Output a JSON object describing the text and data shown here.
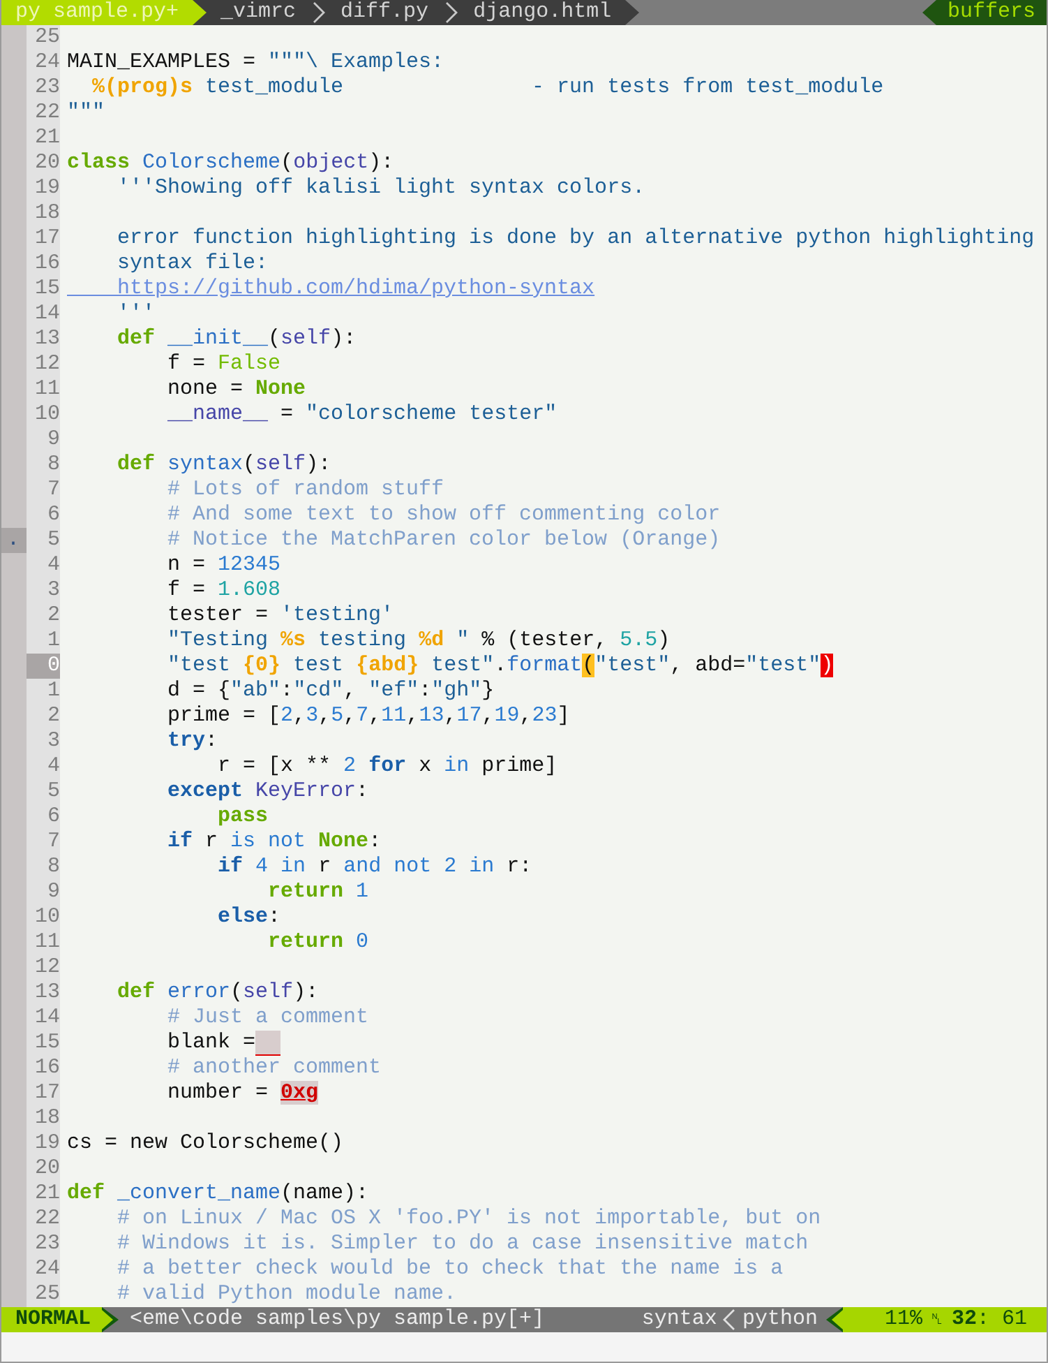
{
  "tabline": {
    "tabs": [
      {
        "label": "py sample.py+",
        "selected": true
      },
      {
        "label": "_vimrc",
        "selected": false
      },
      {
        "label": "diff.py",
        "selected": false
      },
      {
        "label": "django.html",
        "selected": false
      }
    ],
    "buffers_label": "buffers"
  },
  "lines": [
    {
      "number": "25",
      "current": false
    },
    {
      "number": "24",
      "current": false,
      "segments": [
        {
          "text": "MAIN_EXAMPLES = ",
          "kind": "plain"
        },
        {
          "text": "\"\"\"\\ Examples:",
          "kind": "string"
        }
      ]
    },
    {
      "number": "23",
      "current": false,
      "segments": [
        {
          "text": "  %(prog)s",
          "kind": "special"
        },
        {
          "text": " test_module               - run tests from test_module",
          "kind": "string"
        }
      ]
    },
    {
      "number": "22",
      "current": false,
      "segments": [
        {
          "text": "\"\"\"",
          "kind": "string"
        }
      ]
    },
    {
      "number": "21",
      "current": false
    },
    {
      "number": "20",
      "current": false,
      "segments": [
        {
          "text": "class",
          "kind": "keyword"
        },
        {
          "text": " Colorscheme",
          "kind": "function"
        },
        {
          "text": "(",
          "kind": "plain"
        },
        {
          "text": "object",
          "kind": "self"
        },
        {
          "text": "):",
          "kind": "plain"
        }
      ]
    },
    {
      "number": "19",
      "current": false,
      "segments": [
        {
          "text": "    '''Showing off kalisi light syntax colors.",
          "kind": "string"
        }
      ]
    },
    {
      "number": "18",
      "current": false
    },
    {
      "number": "17",
      "current": false,
      "segments": [
        {
          "text": "    error function highlighting is done by an alternative python highlighting",
          "kind": "string"
        }
      ]
    },
    {
      "number": "16",
      "current": false,
      "segments": [
        {
          "text": "    syntax file:",
          "kind": "string"
        }
      ]
    },
    {
      "number": "15",
      "current": false,
      "segments": [
        {
          "text": "    https://github.com/hdima/python-syntax",
          "kind": "url"
        }
      ]
    },
    {
      "number": "14",
      "current": false,
      "segments": [
        {
          "text": "    '''",
          "kind": "string"
        }
      ]
    },
    {
      "number": "13",
      "current": false,
      "segments": [
        {
          "text": "    def",
          "kind": "keyword"
        },
        {
          "text": " __init__",
          "kind": "function"
        },
        {
          "text": "(",
          "kind": "plain"
        },
        {
          "text": "self",
          "kind": "self"
        },
        {
          "text": "):",
          "kind": "plain"
        }
      ]
    },
    {
      "number": "12",
      "current": false,
      "segments": [
        {
          "text": "        f = ",
          "kind": "plain"
        },
        {
          "text": "False",
          "kind": "boolean"
        }
      ]
    },
    {
      "number": "11",
      "current": false,
      "segments": [
        {
          "text": "        none = ",
          "kind": "plain"
        },
        {
          "text": "None",
          "kind": "keyword"
        }
      ]
    },
    {
      "number": "10",
      "current": false,
      "segments": [
        {
          "text": "        __name__",
          "kind": "self"
        },
        {
          "text": " = ",
          "kind": "plain"
        },
        {
          "text": "\"colorscheme tester\"",
          "kind": "string"
        }
      ]
    },
    {
      "number": "9",
      "current": false
    },
    {
      "number": "8",
      "current": false,
      "segments": [
        {
          "text": "    def",
          "kind": "keyword"
        },
        {
          "text": " syntax",
          "kind": "function"
        },
        {
          "text": "(",
          "kind": "plain"
        },
        {
          "text": "self",
          "kind": "self"
        },
        {
          "text": "):",
          "kind": "plain"
        }
      ]
    },
    {
      "number": "7",
      "current": false,
      "segments": [
        {
          "text": "        # Lots of random stuff",
          "kind": "comment"
        }
      ]
    },
    {
      "number": "6",
      "current": false,
      "segments": [
        {
          "text": "        # And some text to show off commenting color",
          "kind": "comment"
        }
      ]
    },
    {
      "number": "5",
      "current": false,
      "sign": ".",
      "segments": [
        {
          "text": "        # Notice the MatchParen color below (Orange)",
          "kind": "comment"
        }
      ]
    },
    {
      "number": "4",
      "current": false,
      "segments": [
        {
          "text": "        n = ",
          "kind": "plain"
        },
        {
          "text": "12345",
          "kind": "number"
        }
      ]
    },
    {
      "number": "3",
      "current": false,
      "segments": [
        {
          "text": "        f = ",
          "kind": "plain"
        },
        {
          "text": "1.608",
          "kind": "float"
        }
      ]
    },
    {
      "number": "2",
      "current": false,
      "segments": [
        {
          "text": "        tester = ",
          "kind": "plain"
        },
        {
          "text": "'testing'",
          "kind": "string"
        }
      ]
    },
    {
      "number": "1",
      "current": false,
      "segments": [
        {
          "text": "        \"Testing ",
          "kind": "string"
        },
        {
          "text": "%s",
          "kind": "special"
        },
        {
          "text": " testing ",
          "kind": "string"
        },
        {
          "text": "%d",
          "kind": "special"
        },
        {
          "text": " \"",
          "kind": "string"
        },
        {
          "text": " % (tester, ",
          "kind": "plain"
        },
        {
          "text": "5.5",
          "kind": "float"
        },
        {
          "text": ")",
          "kind": "plain"
        }
      ]
    },
    {
      "number": "0",
      "current": true,
      "segments": [
        {
          "text": "        \"test ",
          "kind": "string"
        },
        {
          "text": "{0}",
          "kind": "special"
        },
        {
          "text": " test ",
          "kind": "string"
        },
        {
          "text": "{abd}",
          "kind": "special"
        },
        {
          "text": " test\"",
          "kind": "string"
        },
        {
          "text": ".",
          "kind": "plain"
        },
        {
          "text": "format",
          "kind": "function"
        },
        {
          "text": "(",
          "kind": "matchparen"
        },
        {
          "text": "\"test\"",
          "kind": "string"
        },
        {
          "text": ", abd=",
          "kind": "plain"
        },
        {
          "text": "\"test\"",
          "kind": "string"
        },
        {
          "text": ")",
          "kind": "errorparen"
        }
      ]
    },
    {
      "number": "1",
      "current": false,
      "segments": [
        {
          "text": "        d = {",
          "kind": "plain"
        },
        {
          "text": "\"ab\"",
          "kind": "string"
        },
        {
          "text": ":",
          "kind": "plain"
        },
        {
          "text": "\"cd\"",
          "kind": "string"
        },
        {
          "text": ", ",
          "kind": "plain"
        },
        {
          "text": "\"ef\"",
          "kind": "string"
        },
        {
          "text": ":",
          "kind": "plain"
        },
        {
          "text": "\"gh\"",
          "kind": "string"
        },
        {
          "text": "}",
          "kind": "plain"
        }
      ]
    },
    {
      "number": "2",
      "current": false,
      "segments": [
        {
          "text": "        prime = [",
          "kind": "plain"
        },
        {
          "text": "2",
          "kind": "number"
        },
        {
          "text": ",",
          "kind": "plain"
        },
        {
          "text": "3",
          "kind": "number"
        },
        {
          "text": ",",
          "kind": "plain"
        },
        {
          "text": "5",
          "kind": "number"
        },
        {
          "text": ",",
          "kind": "plain"
        },
        {
          "text": "7",
          "kind": "number"
        },
        {
          "text": ",",
          "kind": "plain"
        },
        {
          "text": "11",
          "kind": "number"
        },
        {
          "text": ",",
          "kind": "plain"
        },
        {
          "text": "13",
          "kind": "number"
        },
        {
          "text": ",",
          "kind": "plain"
        },
        {
          "text": "17",
          "kind": "number"
        },
        {
          "text": ",",
          "kind": "plain"
        },
        {
          "text": "19",
          "kind": "number"
        },
        {
          "text": ",",
          "kind": "plain"
        },
        {
          "text": "23",
          "kind": "number"
        },
        {
          "text": "]",
          "kind": "plain"
        }
      ]
    },
    {
      "number": "3",
      "current": false,
      "segments": [
        {
          "text": "        try",
          "kind": "statement"
        },
        {
          "text": ":",
          "kind": "plain"
        }
      ]
    },
    {
      "number": "4",
      "current": false,
      "segments": [
        {
          "text": "            r = [x ** ",
          "kind": "plain"
        },
        {
          "text": "2",
          "kind": "number"
        },
        {
          "text": " for",
          "kind": "statement"
        },
        {
          "text": " x ",
          "kind": "plain"
        },
        {
          "text": "in",
          "kind": "operator"
        },
        {
          "text": " prime]",
          "kind": "plain"
        }
      ]
    },
    {
      "number": "5",
      "current": false,
      "segments": [
        {
          "text": "        except",
          "kind": "statement"
        },
        {
          "text": " KeyError",
          "kind": "self"
        },
        {
          "text": ":",
          "kind": "plain"
        }
      ]
    },
    {
      "number": "6",
      "current": false,
      "segments": [
        {
          "text": "            pass",
          "kind": "keyword"
        }
      ]
    },
    {
      "number": "7",
      "current": false,
      "segments": [
        {
          "text": "        if",
          "kind": "statement"
        },
        {
          "text": " r ",
          "kind": "plain"
        },
        {
          "text": "is not",
          "kind": "operator"
        },
        {
          "text": " None",
          "kind": "keyword"
        },
        {
          "text": ":",
          "kind": "plain"
        }
      ]
    },
    {
      "number": "8",
      "current": false,
      "segments": [
        {
          "text": "            if",
          "kind": "statement"
        },
        {
          "text": " 4",
          "kind": "number"
        },
        {
          "text": " in",
          "kind": "operator"
        },
        {
          "text": " r ",
          "kind": "plain"
        },
        {
          "text": "and not",
          "kind": "operator"
        },
        {
          "text": " 2",
          "kind": "number"
        },
        {
          "text": " in",
          "kind": "operator"
        },
        {
          "text": " r:",
          "kind": "plain"
        }
      ]
    },
    {
      "number": "9",
      "current": false,
      "segments": [
        {
          "text": "                return",
          "kind": "keyword"
        },
        {
          "text": " 1",
          "kind": "number"
        }
      ]
    },
    {
      "number": "10",
      "current": false,
      "segments": [
        {
          "text": "            else",
          "kind": "statement"
        },
        {
          "text": ":",
          "kind": "plain"
        }
      ]
    },
    {
      "number": "11",
      "current": false,
      "segments": [
        {
          "text": "                return",
          "kind": "keyword"
        },
        {
          "text": " 0",
          "kind": "number"
        }
      ]
    },
    {
      "number": "12",
      "current": false
    },
    {
      "number": "13",
      "current": false,
      "segments": [
        {
          "text": "    def",
          "kind": "keyword"
        },
        {
          "text": " error",
          "kind": "function"
        },
        {
          "text": "(",
          "kind": "plain"
        },
        {
          "text": "self",
          "kind": "self"
        },
        {
          "text": "):",
          "kind": "plain"
        }
      ]
    },
    {
      "number": "14",
      "current": false,
      "segments": [
        {
          "text": "        # Just a comment",
          "kind": "comment"
        }
      ]
    },
    {
      "number": "15",
      "current": false,
      "trailing_space_error": true,
      "segments": [
        {
          "text": "        blank =",
          "kind": "plain"
        }
      ]
    },
    {
      "number": "16",
      "current": false,
      "segments": [
        {
          "text": "        # another comment",
          "kind": "comment"
        }
      ]
    },
    {
      "number": "17",
      "current": false,
      "segments": [
        {
          "text": "        number = ",
          "kind": "plain"
        },
        {
          "text": "0xg",
          "kind": "errorvalue"
        }
      ]
    },
    {
      "number": "18",
      "current": false
    },
    {
      "number": "19",
      "current": false,
      "segments": [
        {
          "text": "cs = new Colorscheme()",
          "kind": "plain"
        }
      ]
    },
    {
      "number": "20",
      "current": false
    },
    {
      "number": "21",
      "current": false,
      "segments": [
        {
          "text": "def",
          "kind": "keyword"
        },
        {
          "text": " _convert_name",
          "kind": "function"
        },
        {
          "text": "(name):",
          "kind": "plain"
        }
      ]
    },
    {
      "number": "22",
      "current": false,
      "segments": [
        {
          "text": "    # on Linux / Mac OS X 'foo.PY' is not importable, but on",
          "kind": "comment"
        }
      ]
    },
    {
      "number": "23",
      "current": false,
      "segments": [
        {
          "text": "    # Windows it is. Simpler to do a case insensitive match",
          "kind": "comment"
        }
      ]
    },
    {
      "number": "24",
      "current": false,
      "segments": [
        {
          "text": "    # a better check would be to check that the name is a",
          "kind": "comment"
        }
      ]
    },
    {
      "number": "25",
      "current": false,
      "segments": [
        {
          "text": "    # valid Python module name.",
          "kind": "comment"
        }
      ]
    }
  ],
  "statusline": {
    "mode": "NORMAL",
    "file": "<eme\\code samples\\py sample.py[+]",
    "syntax": "syntax",
    "filetype": "python",
    "percent": "11%",
    "line_symbol": "␤",
    "position": "**32**: 61"
  }
}
